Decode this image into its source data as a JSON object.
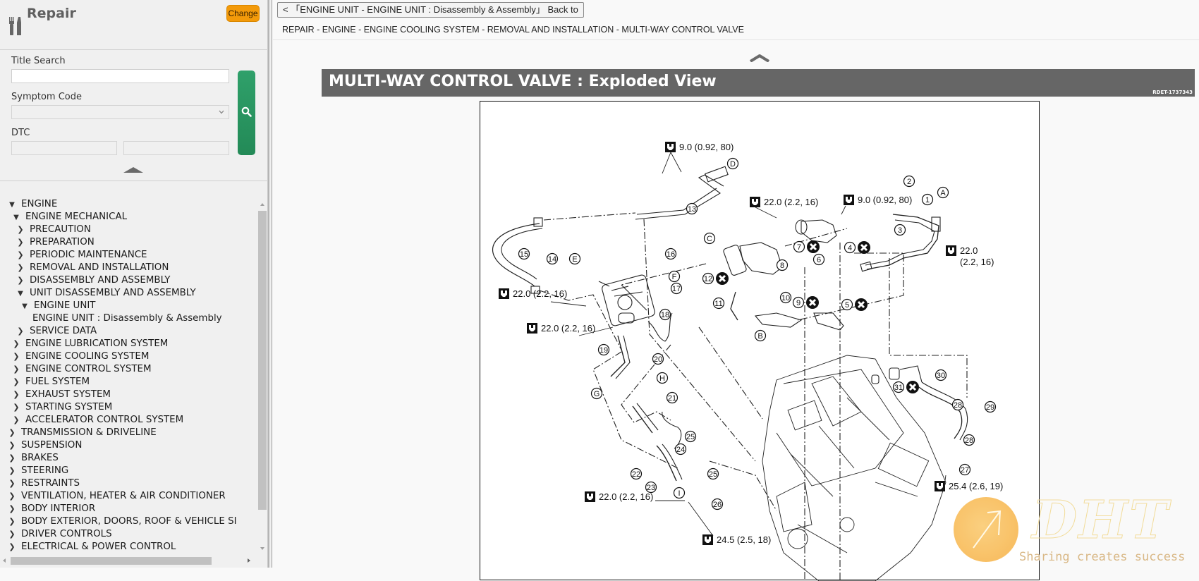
{
  "sidebar": {
    "app_title": "Repair",
    "change_label": "Change",
    "title_search": {
      "label": "Title Search",
      "value": "",
      "placeholder": ""
    },
    "symptom_code": {
      "label": "Symptom Code",
      "selected": ""
    },
    "dtc": {
      "label": "DTC",
      "value1": "",
      "value2": ""
    },
    "search_button_icon": "search-icon",
    "collapse_icon": "chevron-up-icon",
    "tree": [
      {
        "label": "ENGINE",
        "level": 0,
        "state": "open"
      },
      {
        "label": "ENGINE MECHANICAL",
        "level": 1,
        "state": "open"
      },
      {
        "label": "PRECAUTION",
        "level": 2,
        "state": "closed"
      },
      {
        "label": "PREPARATION",
        "level": 2,
        "state": "closed"
      },
      {
        "label": "PERIODIC MAINTENANCE",
        "level": 2,
        "state": "closed"
      },
      {
        "label": "REMOVAL AND INSTALLATION",
        "level": 2,
        "state": "closed"
      },
      {
        "label": "DISASSEMBLY AND ASSEMBLY",
        "level": 2,
        "state": "closed"
      },
      {
        "label": "UNIT DISASSEMBLY AND ASSEMBLY",
        "level": 2,
        "state": "open"
      },
      {
        "label": "ENGINE UNIT",
        "level": 3,
        "state": "open"
      },
      {
        "label": "ENGINE UNIT : Disassembly & Assembly",
        "level": 4,
        "state": "leaf"
      },
      {
        "label": "SERVICE DATA",
        "level": 2,
        "state": "closed"
      },
      {
        "label": "ENGINE LUBRICATION SYSTEM",
        "level": 1,
        "state": "closed"
      },
      {
        "label": "ENGINE COOLING SYSTEM",
        "level": 1,
        "state": "closed"
      },
      {
        "label": "ENGINE CONTROL SYSTEM",
        "level": 1,
        "state": "closed"
      },
      {
        "label": "FUEL SYSTEM",
        "level": 1,
        "state": "closed"
      },
      {
        "label": "EXHAUST SYSTEM",
        "level": 1,
        "state": "closed"
      },
      {
        "label": "STARTING SYSTEM",
        "level": 1,
        "state": "closed"
      },
      {
        "label": "ACCELERATOR CONTROL SYSTEM",
        "level": 1,
        "state": "closed"
      },
      {
        "label": "TRANSMISSION & DRIVELINE",
        "level": 0,
        "state": "closed"
      },
      {
        "label": "SUSPENSION",
        "level": 0,
        "state": "closed"
      },
      {
        "label": "BRAKES",
        "level": 0,
        "state": "closed"
      },
      {
        "label": "STEERING",
        "level": 0,
        "state": "closed"
      },
      {
        "label": "RESTRAINTS",
        "level": 0,
        "state": "closed"
      },
      {
        "label": "VENTILATION, HEATER & AIR CONDITIONER",
        "level": 0,
        "state": "closed"
      },
      {
        "label": "BODY INTERIOR",
        "level": 0,
        "state": "closed"
      },
      {
        "label": "BODY EXTERIOR, DOORS, ROOF & VEHICLE SI",
        "level": 0,
        "state": "closed"
      },
      {
        "label": "DRIVER CONTROLS",
        "level": 0,
        "state": "closed"
      },
      {
        "label": "ELECTRICAL & POWER CONTROL",
        "level": 0,
        "state": "closed"
      }
    ]
  },
  "main": {
    "back_button": "<  「ENGINE UNIT - ENGINE UNIT : Disassembly & Assembly」 Back to",
    "breadcrumb": "REPAIR - ENGINE - ENGINE COOLING SYSTEM - REMOVAL AND INSTALLATION - MULTI-WAY CONTROL VALVE",
    "section_title": "MULTI-WAY CONTROL VALVE : Exploded View",
    "figure_ref": "RDET-1737343",
    "figure": {
      "torque_labels": [
        "9.0 (0.92, 80)",
        "22.0 (2.2, 16)",
        "9.0 (0.92, 80)",
        "22.0",
        "(2.2, 16)",
        "22.0 (2.2, 16)",
        "22.0 (2.2, 16)",
        "22.0 (2.2, 16)",
        "24.5 (2.5, 18)",
        "25.4 (2.6, 19)"
      ],
      "part_numbers": [
        "1",
        "2",
        "3",
        "4",
        "5",
        "6",
        "7",
        "8",
        "9",
        "10",
        "11",
        "12",
        "13",
        "14",
        "15",
        "16",
        "17",
        "18",
        "19",
        "20",
        "21",
        "22",
        "23",
        "24",
        "25",
        "26",
        "27",
        "28",
        "29",
        "30",
        "31"
      ],
      "reference_letters": [
        "A",
        "B",
        "C",
        "D",
        "E",
        "F",
        "G",
        "H",
        "I"
      ],
      "do_not_reuse_parts": [
        "4",
        "5",
        "7",
        "9",
        "12",
        "31"
      ]
    }
  },
  "watermark": {
    "logo_text": "DHT",
    "slogan": "Sharing creates success"
  }
}
